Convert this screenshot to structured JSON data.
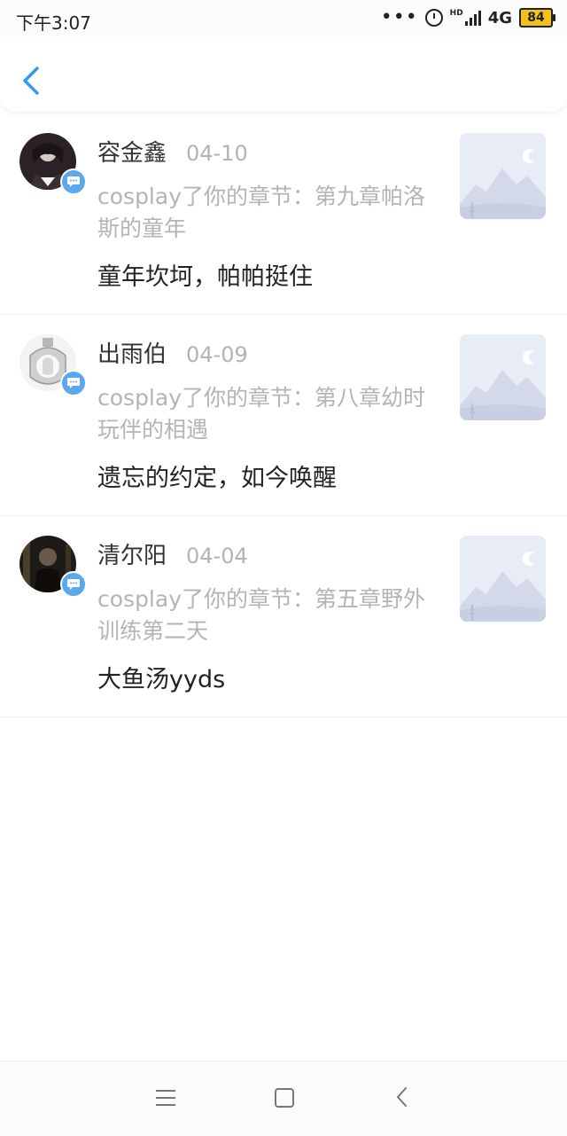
{
  "status_bar": {
    "time": "下午3:07",
    "dots": "•••",
    "network": "4G",
    "battery": "84",
    "hd": "HD"
  },
  "header": {
    "back_icon": "chevron-left-icon",
    "accent_color": "#2f9bf0"
  },
  "notifications": [
    {
      "user": "容金鑫",
      "date": "04-10",
      "description": "cosplay了你的章节：第九章帕洛斯的童年",
      "comment": "童年坎坷，帕帕挺住"
    },
    {
      "user": "出雨伯",
      "date": "04-09",
      "description": "cosplay了你的章节：第八章幼时玩伴的相遇",
      "comment": "遗忘的约定，如今唤醒"
    },
    {
      "user": "清尔阳",
      "date": "04-04",
      "description": "cosplay了你的章节：第五章野外训练第二天",
      "comment": "大鱼汤yyds"
    }
  ],
  "nav_bar": {
    "menu_icon": "menu-icon",
    "home_icon": "home-icon",
    "back_icon": "back-icon"
  }
}
